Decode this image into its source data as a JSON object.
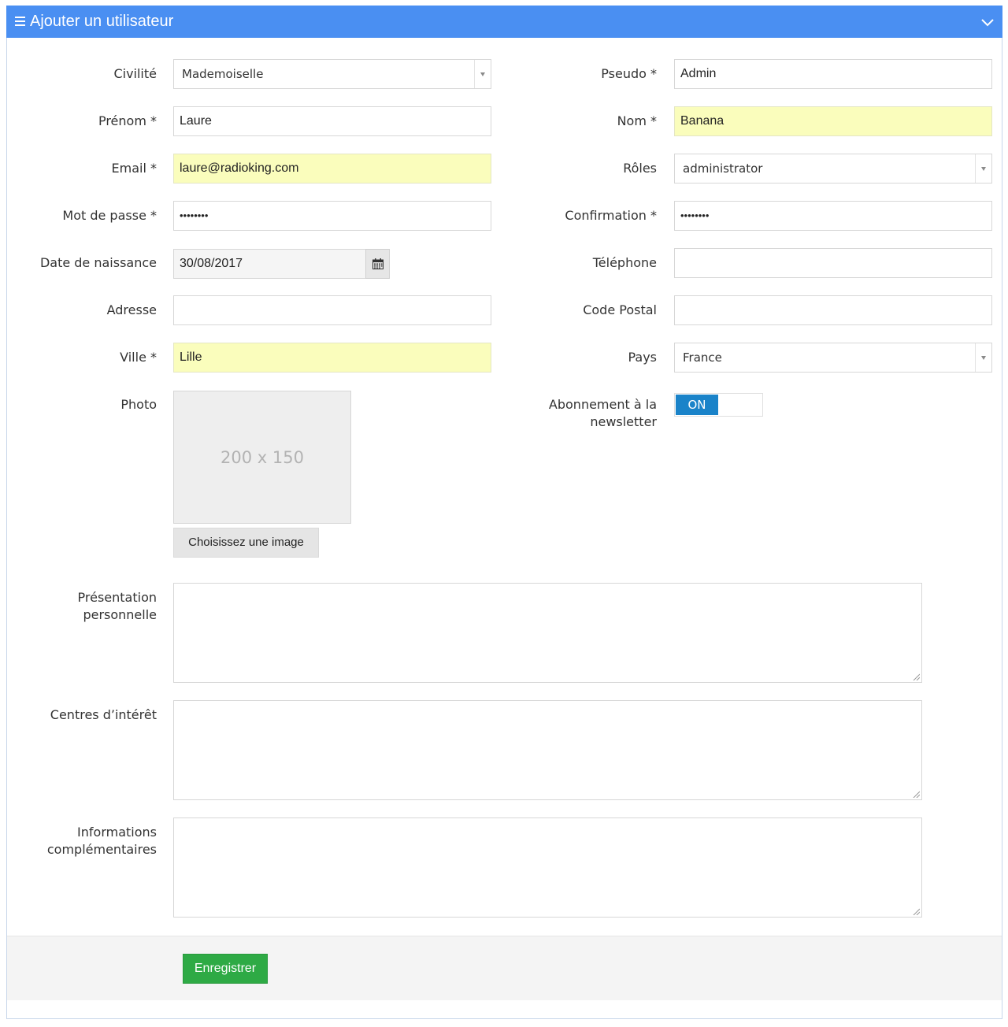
{
  "header": {
    "title": "Ajouter un utilisateur",
    "menu_icon": "hamburger-icon",
    "collapse_icon": "chevron-down-icon",
    "background_color": "#4a8ff2"
  },
  "form": {
    "civilite": {
      "label": "Civilité",
      "value": "Mademoiselle"
    },
    "pseudo": {
      "label": "Pseudo *",
      "value": "Admin"
    },
    "prenom": {
      "label": "Prénom *",
      "value": "Laure"
    },
    "nom": {
      "label": "Nom *",
      "value": "Banana"
    },
    "email": {
      "label": "Email *",
      "value": "laure@radioking.com"
    },
    "roles": {
      "label": "Rôles",
      "value": "administrator"
    },
    "password": {
      "label": "Mot de passe *",
      "value": "••••••••"
    },
    "confirmation": {
      "label": "Confirmation *",
      "value": "••••••••"
    },
    "date_naissance": {
      "label": "Date de naissance",
      "value": "30/08/2017",
      "icon": "calendar-icon"
    },
    "telephone": {
      "label": "Téléphone",
      "value": ""
    },
    "adresse": {
      "label": "Adresse",
      "value": ""
    },
    "code_postal": {
      "label": "Code Postal",
      "value": ""
    },
    "ville": {
      "label": "Ville *",
      "value": "Lille"
    },
    "pays": {
      "label": "Pays",
      "value": "France"
    },
    "photo": {
      "label": "Photo",
      "placeholder_text": "200 x 150",
      "choose_button": "Choisissez une image"
    },
    "newsletter": {
      "label_line1": "Abonnement à la",
      "label_line2": "newsletter",
      "toggle_text": "ON",
      "on": true
    },
    "presentation": {
      "label_line1": "Présentation",
      "label_line2": "personnelle",
      "value": ""
    },
    "centres_interet": {
      "label": "Centres d’intérêt",
      "value": ""
    },
    "informations": {
      "label_line1": "Informations",
      "label_line2": "complémentaires",
      "value": ""
    }
  },
  "footer": {
    "save_label": "Enregistrer",
    "save_color": "#2eaa45"
  },
  "colors": {
    "highlight": "#fafdbc",
    "toggle_on": "#1a83c9"
  }
}
